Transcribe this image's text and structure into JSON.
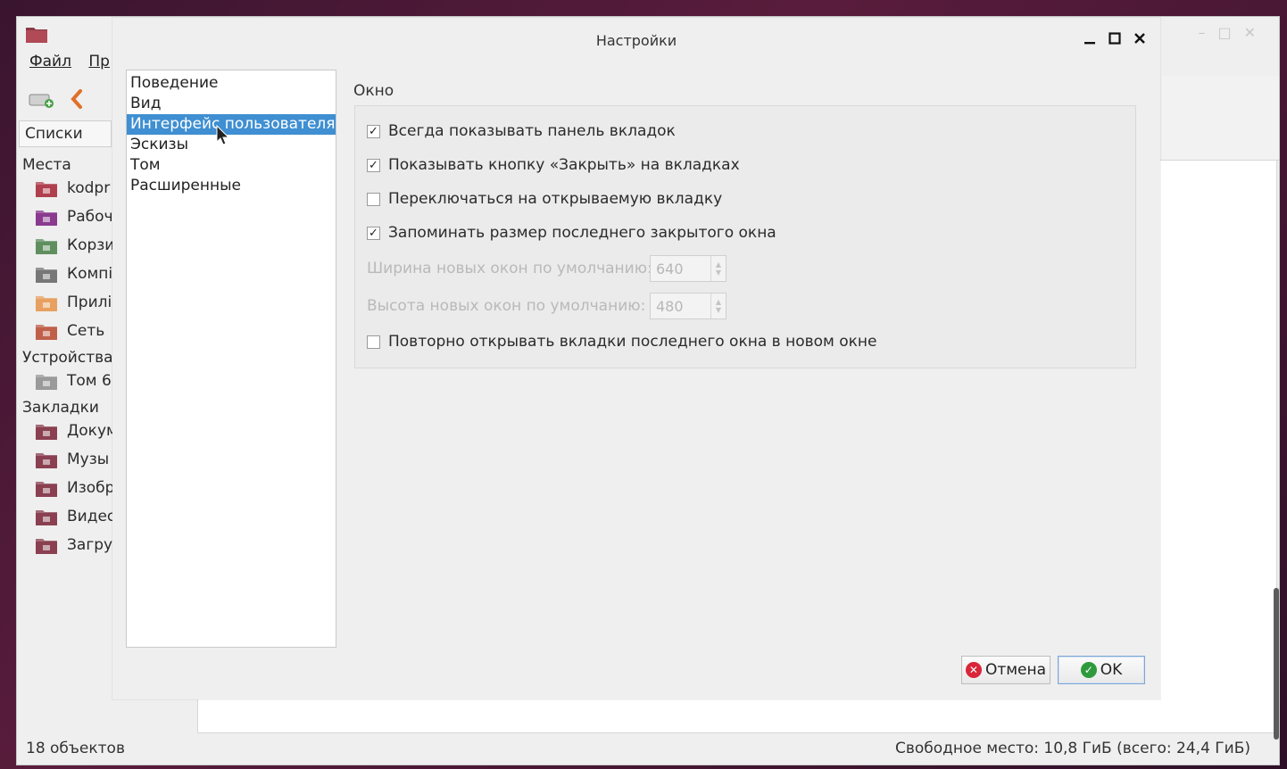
{
  "file_manager": {
    "menu": [
      "Файл",
      "Пр"
    ],
    "panel_selector": "Списки",
    "sidebar": {
      "places_header": "Места",
      "places": [
        {
          "label": "kodpr",
          "icon": "home-folder-icon",
          "color": "#b0404e"
        },
        {
          "label": "Рабоч",
          "icon": "desktop-folder-icon",
          "color": "#8a3a8f"
        },
        {
          "label": "Корзи",
          "icon": "trash-icon",
          "color": "#5f8f5f"
        },
        {
          "label": "Компі",
          "icon": "computer-icon",
          "color": "#777777"
        },
        {
          "label": "Прилі",
          "icon": "applications-icon",
          "color": "#e8a060"
        },
        {
          "label": "Сеть",
          "icon": "network-folder-icon",
          "color": "#c0604a"
        }
      ],
      "devices_header": "Устройства",
      "devices": [
        {
          "label": "Том 6",
          "icon": "usb-drive-icon",
          "color": "#9a9a9a"
        }
      ],
      "bookmarks_header": "Закладки",
      "bookmarks": [
        {
          "label": "Докум",
          "icon": "documents-folder-icon",
          "color": "#8a4050"
        },
        {
          "label": "Музы",
          "icon": "music-folder-icon",
          "color": "#8a4050"
        },
        {
          "label": "Изобр",
          "icon": "pictures-folder-icon",
          "color": "#8a4050"
        },
        {
          "label": "Видес",
          "icon": "videos-folder-icon",
          "color": "#8a4050"
        },
        {
          "label": "Загру",
          "icon": "downloads-folder-icon",
          "color": "#8a4050"
        }
      ]
    },
    "status_left": "18 объектов",
    "status_right": "Свободное место: 10,8 ГиБ (всего: 24,4 ГиБ)"
  },
  "dialog": {
    "title": "Настройки",
    "categories": [
      "Поведение",
      "Вид",
      "Интерфейс пользователя",
      "Эскизы",
      "Том",
      "Расширенные"
    ],
    "selected_category_index": 2,
    "group_title": "Окно",
    "options": [
      {
        "label": "Всегда показывать панель вкладок",
        "checked": true
      },
      {
        "label": "Показывать кнопку «Закрыть» на вкладках",
        "checked": true
      },
      {
        "label": "Переключаться на открываемую вкладку",
        "checked": false
      },
      {
        "label": "Запоминать размер последнего закрытого окна",
        "checked": true
      }
    ],
    "width_label": "Ширина новых окон по умолчанию:",
    "width_value": "640",
    "height_label": "Высота новых окон по умолчанию:",
    "height_value": "480",
    "reopen_option": {
      "label": "Повторно открывать вкладки последнего окна в новом окне",
      "checked": false
    },
    "cancel_label": "Отмена",
    "ok_label": "OK",
    "check_mark": "✓"
  },
  "colors": {
    "selection": "#3f8fd2",
    "cancel_icon": "#d9263a",
    "ok_icon": "#2e9a3c"
  }
}
